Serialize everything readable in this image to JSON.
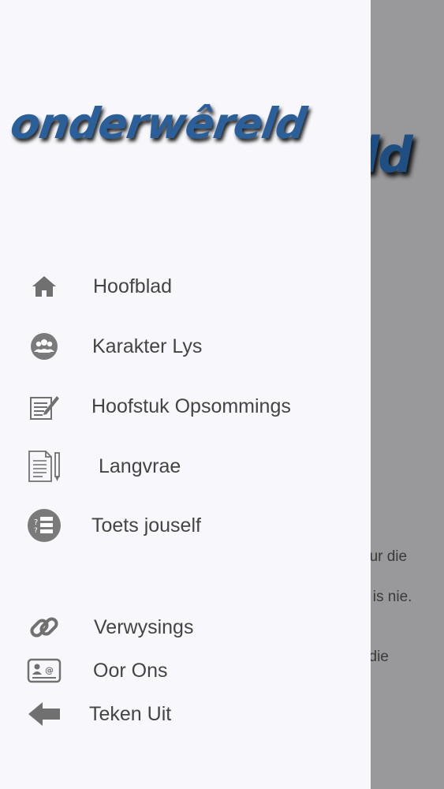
{
  "app": {
    "logo_text": "onderwêreld"
  },
  "background": {
    "logo_tail": "ld",
    "text_lines": [
      "eur die",
      "s is nie.",
      "l die"
    ]
  },
  "menu": {
    "items": [
      {
        "label": "Hoofblad",
        "icon": "home-icon"
      },
      {
        "label": "Karakter Lys",
        "icon": "group-icon"
      },
      {
        "label": "Hoofstuk Opsommings",
        "icon": "edit-document-icon"
      },
      {
        "label": "Langvrae",
        "icon": "document-pen-icon"
      },
      {
        "label": "Toets jouself",
        "icon": "quiz-icon"
      }
    ],
    "secondary_items": [
      {
        "label": "Verwysings",
        "icon": "link-icon"
      },
      {
        "label": "Oor Ons",
        "icon": "contact-card-icon"
      },
      {
        "label": "Teken Uit",
        "icon": "arrow-left-icon"
      }
    ]
  },
  "colors": {
    "drawer_bg": "#f8f8fc",
    "overlay": "#99999c",
    "logo_blue": "#2a5f99",
    "icon_gray": "#707070",
    "label_text": "#444444"
  }
}
